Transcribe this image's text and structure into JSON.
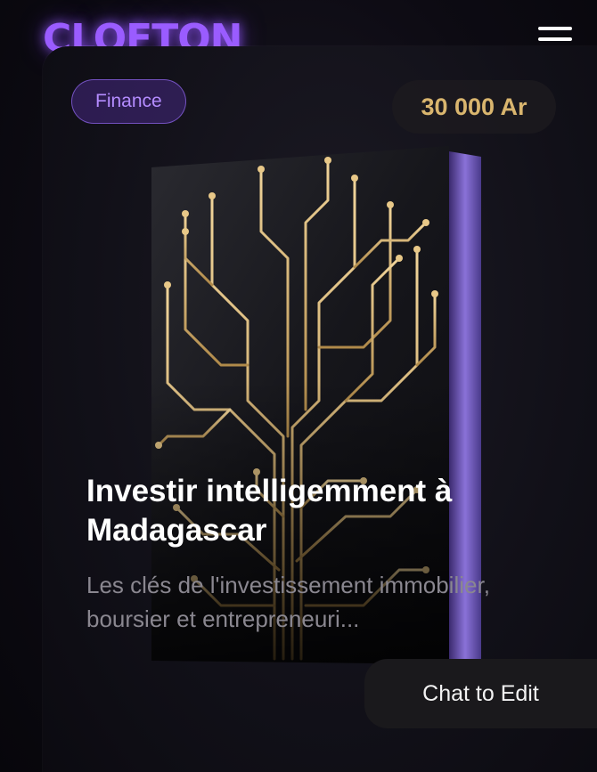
{
  "header": {
    "logo": "CLOFTON",
    "menu_icon": "hamburger-menu-icon"
  },
  "product": {
    "category": "Finance",
    "price": "30 000 Ar",
    "title": "Investir intelligemment à Madagascar",
    "subtitle": "Les clés de l'investissement immobilier, boursier et entrepreneuri...",
    "cover_image": "book-cover-circuit-tree"
  },
  "chat": {
    "label": "Chat to Edit"
  },
  "colors": {
    "brand": "#9a5cff",
    "price": "#d9b56e",
    "background": "#0c0a12"
  }
}
